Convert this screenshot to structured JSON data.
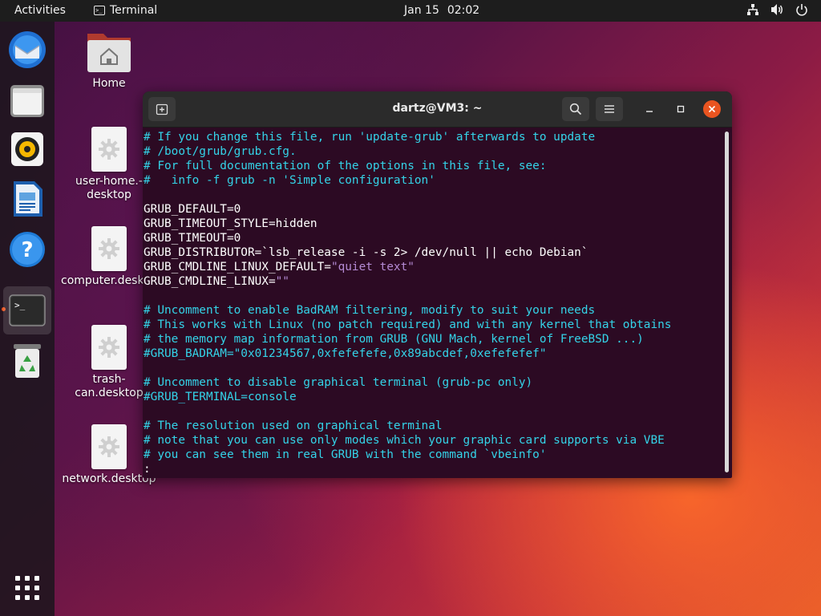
{
  "topbar": {
    "activities": "Activities",
    "app_name": "Terminal",
    "date": "Jan 15",
    "time": "02:02"
  },
  "dock": {
    "items": [
      {
        "name": "thunderbird",
        "icon": "mail-icon"
      },
      {
        "name": "files",
        "icon": "folder-icon"
      },
      {
        "name": "rhythmbox",
        "icon": "speaker-icon"
      },
      {
        "name": "writer",
        "icon": "document-icon"
      },
      {
        "name": "help",
        "icon": "help-icon"
      },
      {
        "name": "terminal",
        "icon": "terminal-icon",
        "active": true
      },
      {
        "name": "trash",
        "icon": "trash-icon"
      }
    ],
    "show_apps_icon": "grid-icon"
  },
  "desktop": {
    "icons": [
      {
        "label": "Home"
      },
      {
        "label": "user-home.-\ndesktop"
      },
      {
        "label": "computer.desktop"
      },
      {
        "label": "trash-can.desktop"
      },
      {
        "label": "network.desktop"
      }
    ]
  },
  "window": {
    "title": "dartz@VM3: ~",
    "lines": [
      [
        {
          "t": "# If you change this file, run 'update-grub' afterwards to update",
          "c": "comment"
        }
      ],
      [
        {
          "t": "# /boot/grub/grub.cfg.",
          "c": "comment"
        }
      ],
      [
        {
          "t": "# For full documentation of the options in this file, see:",
          "c": "comment"
        }
      ],
      [
        {
          "t": "#   info -f grub -n 'Simple configuration'",
          "c": "comment"
        }
      ],
      [
        {
          "t": "",
          "c": "normal"
        }
      ],
      [
        {
          "t": "GRUB_DEFAULT=0",
          "c": "normal"
        }
      ],
      [
        {
          "t": "GRUB_TIMEOUT_STYLE=hidden",
          "c": "normal"
        }
      ],
      [
        {
          "t": "GRUB_TIMEOUT=0",
          "c": "normal"
        }
      ],
      [
        {
          "t": "GRUB_DISTRIBUTOR=`lsb_release -i -s 2> /dev/null || echo Debian`",
          "c": "normal"
        }
      ],
      [
        {
          "t": "GRUB_CMDLINE_LINUX_DEFAULT=",
          "c": "normal"
        },
        {
          "t": "\"quiet text\"",
          "c": "string"
        }
      ],
      [
        {
          "t": "GRUB_CMDLINE_LINUX=",
          "c": "normal"
        },
        {
          "t": "\"\"",
          "c": "string"
        }
      ],
      [
        {
          "t": "",
          "c": "normal"
        }
      ],
      [
        {
          "t": "# Uncomment to enable BadRAM filtering, modify to suit your needs",
          "c": "comment"
        }
      ],
      [
        {
          "t": "# This works with Linux (no patch required) and with any kernel that obtains",
          "c": "comment"
        }
      ],
      [
        {
          "t": "# the memory map information from GRUB (GNU Mach, kernel of FreeBSD ...)",
          "c": "comment"
        }
      ],
      [
        {
          "t": "#GRUB_BADRAM=\"0x01234567,0xfefefefe,0x89abcdef,0xefefefef\"",
          "c": "comment"
        }
      ],
      [
        {
          "t": "",
          "c": "normal"
        }
      ],
      [
        {
          "t": "# Uncomment to disable graphical terminal (grub-pc only)",
          "c": "comment"
        }
      ],
      [
        {
          "t": "#GRUB_TERMINAL=console",
          "c": "comment"
        }
      ],
      [
        {
          "t": "",
          "c": "normal"
        }
      ],
      [
        {
          "t": "# The resolution used on graphical terminal",
          "c": "comment"
        }
      ],
      [
        {
          "t": "# note that you can use only modes which your graphic card supports via VBE",
          "c": "comment"
        }
      ],
      [
        {
          "t": "# you can see them in real GRUB with the command `vbeinfo'",
          "c": "comment"
        }
      ],
      [
        {
          "t": ":",
          "c": "normal"
        }
      ]
    ]
  },
  "colors": {
    "accent": "#e95420",
    "terminal_bg": "#2c0a23",
    "comment": "#34d3e8",
    "string": "#b48ad4"
  }
}
